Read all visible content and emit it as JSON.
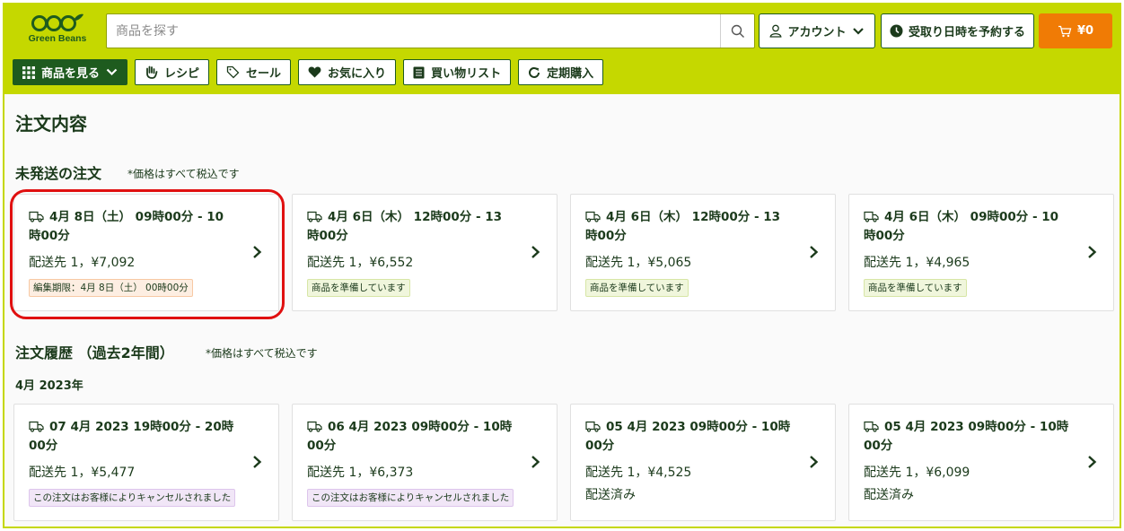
{
  "brand": {
    "logo_text": "Green Beans",
    "primary_color": "#c5d800",
    "dark_green": "#1e5b1e",
    "cart_color": "#f07b05",
    "highlight_color": "#e01010"
  },
  "search": {
    "placeholder": "商品を探す"
  },
  "header": {
    "account_label": "アカウント",
    "reserve_label": "受取り日時を予約する",
    "cart_label": "¥0"
  },
  "nav": {
    "items": [
      {
        "label": "商品を見る",
        "icon": "grid-icon"
      },
      {
        "label": "レシピ",
        "icon": "hand-icon"
      },
      {
        "label": "セール",
        "icon": "tag-icon"
      },
      {
        "label": "お気に入り",
        "icon": "heart-icon"
      },
      {
        "label": "買い物リスト",
        "icon": "list-icon"
      },
      {
        "label": "定期購入",
        "icon": "refresh-icon"
      }
    ]
  },
  "page": {
    "title": "注文内容"
  },
  "pending": {
    "title": "未発送の注文",
    "note": "*価格はすべて税込です",
    "orders": [
      {
        "title": "4月 8日（土） 09時00分 - 10時00分",
        "sub": "配送先 1，¥7,092",
        "badge": "編集期限：4月 8日（土） 00時00分",
        "badge_style": "orange"
      },
      {
        "title": "4月 6日（木） 12時00分 - 13時00分",
        "sub": "配送先 1，¥6,552",
        "badge": "商品を準備しています",
        "badge_style": "green"
      },
      {
        "title": "4月 6日（木） 12時00分 - 13時00分",
        "sub": "配送先 1，¥5,065",
        "badge": "商品を準備しています",
        "badge_style": "green"
      },
      {
        "title": "4月 6日（木） 09時00分 - 10時00分",
        "sub": "配送先 1，¥4,965",
        "badge": "商品を準備しています",
        "badge_style": "green"
      }
    ]
  },
  "history": {
    "title": "注文履歴 （過去2年間）",
    "note": "*価格はすべて税込です",
    "month": "4月 2023年",
    "orders": [
      {
        "title": "07 4月 2023 19時00分 - 20時00分",
        "sub": "配送先 1，¥5,477",
        "badge": "この注文はお客様によりキャンセルされました",
        "badge_style": "purple"
      },
      {
        "title": "06 4月 2023 09時00分 - 10時00分",
        "sub": "配送先 1，¥6,373",
        "badge": "この注文はお客様によりキャンセルされました",
        "badge_style": "purple"
      },
      {
        "title": "05 4月 2023 09時00分 - 10時00分",
        "sub": "配送先 1，¥4,525",
        "status": "配送済み"
      },
      {
        "title": "05 4月 2023 09時00分 - 10時00分",
        "sub": "配送先 1，¥6,099",
        "status": "配送済み"
      }
    ]
  }
}
